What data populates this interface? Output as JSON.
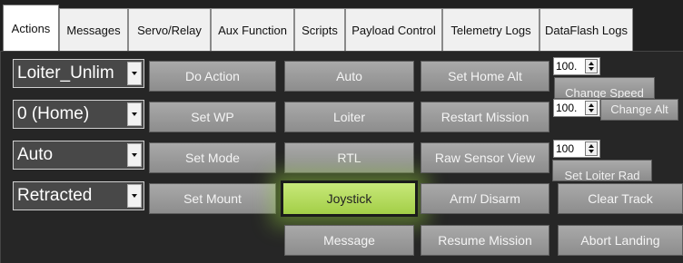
{
  "tabs": [
    {
      "label": "Actions"
    },
    {
      "label": "Messages"
    },
    {
      "label": "Servo/Relay"
    },
    {
      "label": "Aux Function"
    },
    {
      "label": "Scripts"
    },
    {
      "label": "Payload Control"
    },
    {
      "label": "Telemetry Logs"
    },
    {
      "label": "DataFlash Logs"
    }
  ],
  "active_tab": "Actions",
  "combos": {
    "mode": "Loiter_Unlim",
    "waypoint": "0 (Home)",
    "set_mode": "Auto",
    "mount": "Retracted"
  },
  "buttons": {
    "do_action": "Do Action",
    "set_wp": "Set WP",
    "set_mode": "Set Mode",
    "set_mount": "Set Mount",
    "auto": "Auto",
    "loiter": "Loiter",
    "rtl": "RTL",
    "joystick": "Joystick",
    "message": "Message",
    "set_home_alt": "Set Home Alt",
    "restart_mission": "Restart Mission",
    "raw_sensor_view": "Raw Sensor View",
    "arm_disarm": "Arm/ Disarm",
    "resume_mission": "Resume Mission",
    "clear_track": "Clear Track",
    "abort_landing": "Abort Landing"
  },
  "spinners": {
    "speed": "100.",
    "alt": "100.",
    "loiter_rad": "100"
  },
  "small_buttons": {
    "change_speed": "Change Speed",
    "change_alt": "Change Alt",
    "set_loiter_rad": "Set Loiter Rad"
  },
  "colors": {
    "panel_bg": "#262626",
    "highlight": "#a3cf47"
  }
}
